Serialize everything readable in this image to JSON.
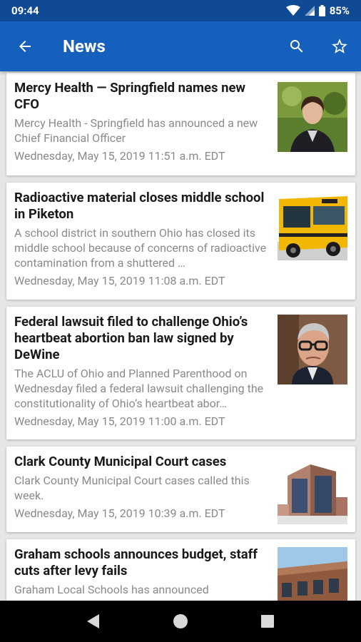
{
  "status_bar": {
    "time": "09:44",
    "battery": "85%"
  },
  "app_bar": {
    "title": "News",
    "back_icon": "arrow-back-icon",
    "search_icon": "search-icon",
    "favorite_icon": "star-outline-icon"
  },
  "articles": [
    {
      "title": "Mercy Health — Springfield names new CFO",
      "summary": "Mercy Health - Springfield has announced a new Chief Financial Officer",
      "date": "Wednesday, May 15, 2019 11:51 a.m. EDT"
    },
    {
      "title": "Radioactive material closes middle school in Piketon",
      "summary": "A school district in southern Ohio has closed its middle school because of concerns of radioactive contamination from a shuttered …",
      "date": "Wednesday, May 15, 2019 11:08 a.m. EDT"
    },
    {
      "title": "Federal lawsuit filed to challenge Ohio’s heartbeat abortion ban law signed by DeWine",
      "summary": "The ACLU of Ohio and Planned Parenthood on Wednesday filed a federal lawsuit challenging the constitutionality of Ohio’s heartbeat abor…",
      "date": "Wednesday, May 15, 2019 11:00 a.m. EDT"
    },
    {
      "title": "Clark County Municipal Court cases",
      "summary": "Clark County Municipal Court cases called this week.",
      "date": "Wednesday, May 15, 2019 10:39 a.m. EDT"
    },
    {
      "title": "Graham schools announces budget, staff cuts after levy fails",
      "summary": "Graham Local Schools has announced",
      "date": ""
    }
  ],
  "colors": {
    "app_bar": "#1560bd",
    "status_bar": "#104a95",
    "background": "#e6e6e6",
    "title_text": "#1a1a1a",
    "secondary_text": "#8a8a8a"
  }
}
